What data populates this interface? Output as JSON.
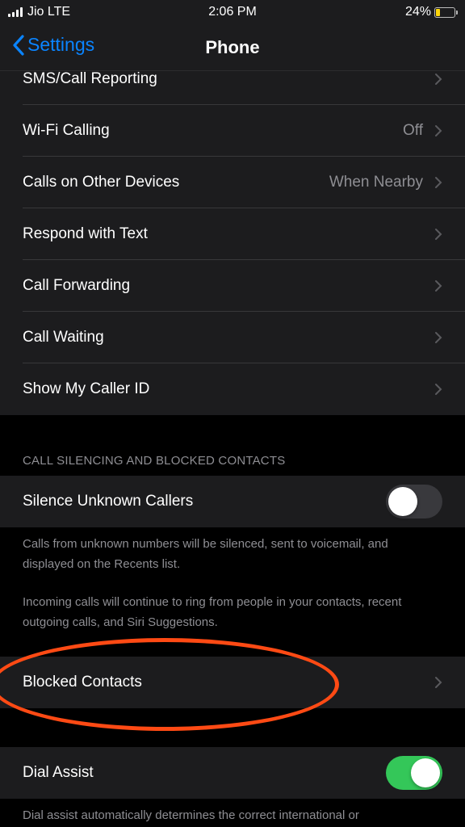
{
  "status_bar": {
    "carrier": "Jio LTE",
    "time": "2:06 PM",
    "battery_percent": "24%",
    "battery_level": 0.24
  },
  "nav": {
    "back_label": "Settings",
    "title": "Phone"
  },
  "top_rows": [
    {
      "label": "SMS/Call Reporting",
      "value": ""
    },
    {
      "label": "Wi-Fi Calling",
      "value": "Off"
    },
    {
      "label": "Calls on Other Devices",
      "value": "When Nearby"
    },
    {
      "label": "Respond with Text",
      "value": ""
    },
    {
      "label": "Call Forwarding",
      "value": ""
    },
    {
      "label": "Call Waiting",
      "value": ""
    },
    {
      "label": "Show My Caller ID",
      "value": ""
    }
  ],
  "silencing_section": {
    "header": "CALL SILENCING AND BLOCKED CONTACTS",
    "silence_label": "Silence Unknown Callers",
    "silence_on": false,
    "footer_1": "Calls from unknown numbers will be silenced, sent to voicemail, and displayed on the Recents list.",
    "footer_2": "Incoming calls will continue to ring from people in your contacts, recent outgoing calls, and Siri Suggestions."
  },
  "blocked": {
    "label": "Blocked Contacts"
  },
  "dial_assist": {
    "label": "Dial Assist",
    "on": true,
    "footer": "Dial assist automatically determines the correct international or"
  },
  "colors": {
    "accent": "#0a84ff",
    "toggle_on": "#34c759",
    "annotation": "#ff4a14",
    "background": "#000000",
    "cell": "#1c1c1e"
  }
}
